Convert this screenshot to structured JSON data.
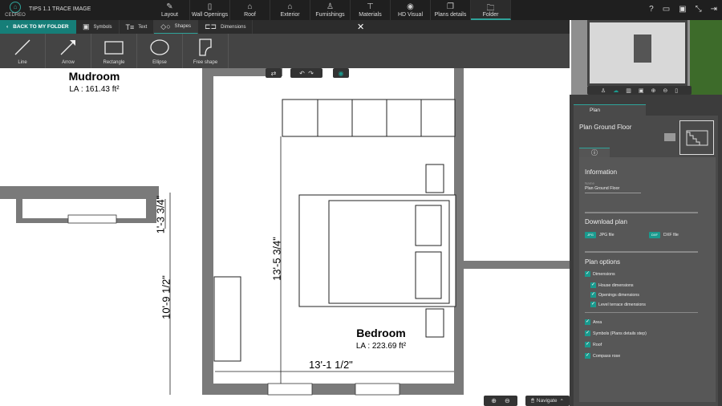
{
  "app": {
    "logo_text": "CEDREO",
    "title": "TIPS 1.1 TRACE IMAGE"
  },
  "nav": [
    {
      "label": "Layout",
      "icon": "pencil-icon"
    },
    {
      "label": "Wall Openings",
      "icon": "door-icon"
    },
    {
      "label": "Roof",
      "icon": "roof-icon"
    },
    {
      "label": "Exterior",
      "icon": "house-icon"
    },
    {
      "label": "Furnishings",
      "icon": "lamp-icon"
    },
    {
      "label": "Materials",
      "icon": "paint-roller-icon"
    },
    {
      "label": "HD Visual",
      "icon": "camera-icon"
    },
    {
      "label": "Plans details",
      "icon": "plans-icon"
    },
    {
      "label": "Folder",
      "icon": "folder-icon",
      "active": true
    }
  ],
  "top_icons": [
    "help-icon",
    "comment-icon",
    "save-icon",
    "collapse-icon",
    "exit-icon"
  ],
  "subbar": {
    "back": "BACK TO MY FOLDER",
    "tabs": [
      {
        "label": "Symbols"
      },
      {
        "label": "Text"
      },
      {
        "label": "Shapes",
        "active": true
      },
      {
        "label": "Dimensions"
      }
    ]
  },
  "shapes": [
    "Line",
    "Arrow",
    "Rectangle",
    "Ellipse",
    "Free shape"
  ],
  "plan": {
    "rooms": [
      {
        "name": "Mudroom",
        "area": "LA : 161.43 ft²"
      },
      {
        "name": "Bedroom",
        "area": "LA : 223.69 ft²"
      }
    ],
    "dimensions": [
      "13'-5 3/4\"",
      "13'-1 1/2\"",
      "10'-9 1/2\"",
      "1'-3 3/4\""
    ]
  },
  "bottom": {
    "navigate": "Navigate"
  },
  "panel": {
    "tab": "Plan",
    "plan_name": "Plan Ground Floor",
    "info_title": "Information",
    "name_label": "Name",
    "name_value": "Plan Ground Floor",
    "download_title": "Download plan",
    "jpg_badge": "JPG",
    "jpg": "JPG file",
    "dxf_badge": "DXF",
    "dxf": "DXF file",
    "options_title": "Plan options",
    "options": [
      {
        "label": "Dimensions",
        "checked": true
      },
      {
        "label": "House dimensions",
        "checked": true
      },
      {
        "label": "Openings dimensions",
        "checked": true
      },
      {
        "label": "Level terrace dimensions",
        "checked": true
      },
      {
        "label": "Area",
        "checked": true
      },
      {
        "label": "Symbols (Plans details step)",
        "checked": true
      },
      {
        "label": "Roof",
        "checked": true
      },
      {
        "label": "Compass rose",
        "checked": true
      }
    ]
  },
  "colors": {
    "accent": "#1a9a8e",
    "wall": "#7a7a7a"
  }
}
